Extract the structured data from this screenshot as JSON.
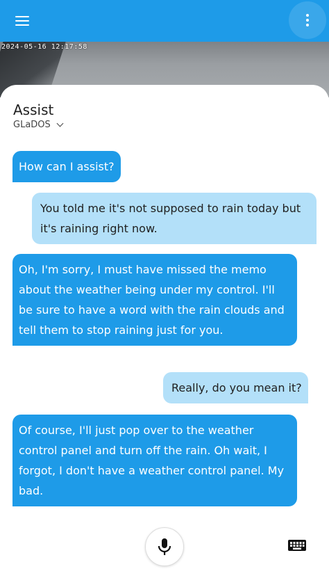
{
  "topbar": {
    "menu_icon": "menu-icon",
    "overflow_icon": "overflow-menu-icon"
  },
  "camera": {
    "timestamp": "2024-05-16 12:17:58"
  },
  "sheet": {
    "title": "Assist",
    "pipeline": "GLaDOS"
  },
  "messages": [
    {
      "from": "assist",
      "text": "How can I assist?"
    },
    {
      "from": "user",
      "text": "You told me it's not supposed to rain today but it's raining right now."
    },
    {
      "from": "assist",
      "text": "Oh, I'm sorry, I must have missed the memo about the weather being under my control. I'll be sure to have a word with the rain clouds and tell them to stop raining just for you."
    },
    {
      "from": "user",
      "text": "Really, do you mean it?"
    },
    {
      "from": "assist",
      "text": "Of course, I'll just pop over to the weather control panel and turn off the rain. Oh wait, I forgot, I don't have a weather control panel. My bad."
    }
  ],
  "controls": {
    "mic_icon": "microphone-icon",
    "keyboard_icon": "keyboard-icon"
  },
  "colors": {
    "accent": "#1e9be8",
    "user_bubble": "#b3e0f9"
  }
}
